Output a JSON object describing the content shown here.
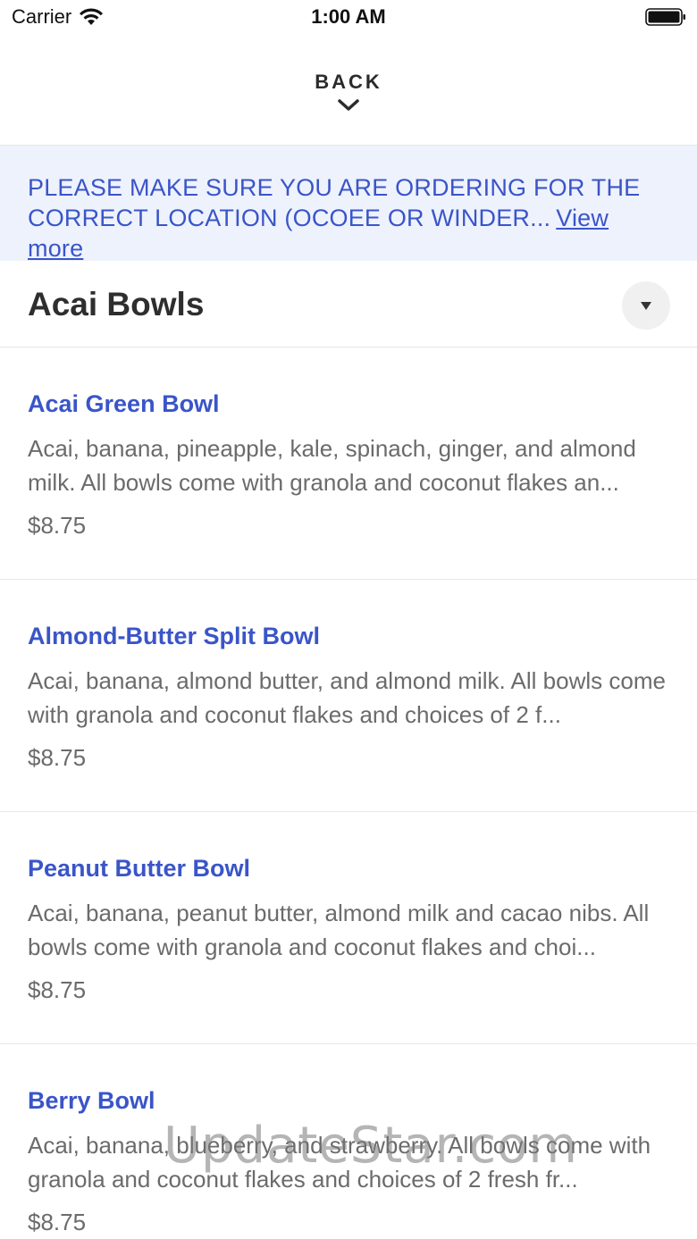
{
  "status_bar": {
    "carrier": "Carrier",
    "time": "1:00 AM"
  },
  "nav": {
    "back_label": "BACK"
  },
  "notice": {
    "text": "PLEASE MAKE SURE YOU ARE ORDERING FOR THE CORRECT LOCATION (OCOEE OR WINDER...",
    "link_label": "View more"
  },
  "category": {
    "title": "Acai Bowls"
  },
  "items": [
    {
      "name": "Acai Green Bowl",
      "description": "Acai, banana, pineapple, kale, spinach, ginger, and almond milk. All bowls come with granola and coconut flakes an...",
      "price": "$8.75"
    },
    {
      "name": "Almond-Butter Split Bowl",
      "description": "Acai, banana, almond butter, and almond milk. All bowls come with granola and coconut flakes and choices of 2 f...",
      "price": "$8.75"
    },
    {
      "name": "Peanut Butter Bowl",
      "description": "Acai, banana, peanut butter, almond milk and cacao nibs. All bowls come with granola and coconut flakes and choi...",
      "price": "$8.75"
    },
    {
      "name": "Berry Bowl",
      "description": "Acai, banana, blueberry, and strawberry. All bowls come with granola and coconut flakes and choices of 2 fresh fr...",
      "price": "$8.75"
    }
  ],
  "watermark": "UpdateStar.com",
  "icons": {
    "wifi": "wifi-icon",
    "battery": "battery-icon",
    "back": "chevron-down-icon",
    "collapse": "caret-down-icon"
  },
  "colors": {
    "accent": "#3a55c8",
    "notice_bg": "#eef2fd",
    "muted_text": "#6b6b6b"
  }
}
